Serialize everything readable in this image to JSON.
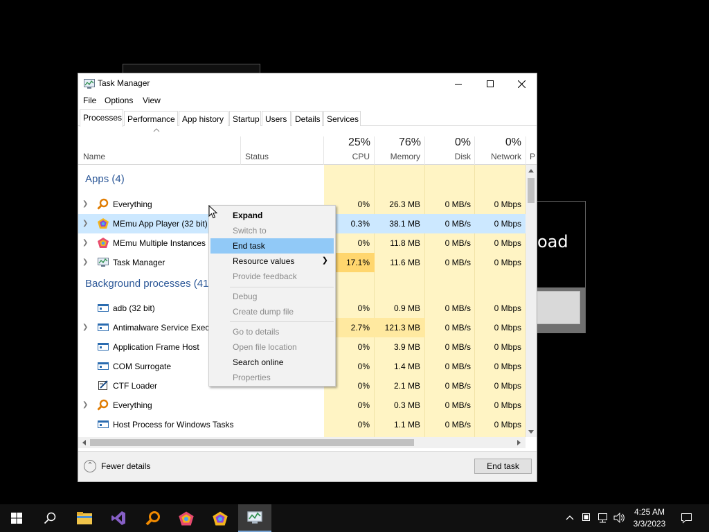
{
  "window": {
    "title": "Task Manager",
    "menu": [
      "File",
      "Options",
      "View"
    ],
    "tabs": [
      "Processes",
      "Performance",
      "App history",
      "Startup",
      "Users",
      "Details",
      "Services"
    ]
  },
  "columns": {
    "name": "Name",
    "status": "Status",
    "cpu": {
      "pct": "25%",
      "label": "CPU"
    },
    "memory": {
      "pct": "76%",
      "label": "Memory"
    },
    "disk": {
      "pct": "0%",
      "label": "Disk"
    },
    "network": {
      "pct": "0%",
      "label": "Network"
    },
    "power_partial": "P"
  },
  "groups": {
    "apps": "Apps (4)",
    "background": "Background processes (41"
  },
  "apps": [
    {
      "name": "Everything",
      "cpu": "0%",
      "mem": "26.3 MB",
      "disk": "0 MB/s",
      "net": "0 Mbps"
    },
    {
      "name": "MEmu App Player (32 bit)",
      "cpu": "0.3%",
      "mem": "38.1 MB",
      "disk": "0 MB/s",
      "net": "0 Mbps"
    },
    {
      "name": "MEmu Multiple Instances",
      "cpu": "0%",
      "mem": "11.8 MB",
      "disk": "0 MB/s",
      "net": "0 Mbps"
    },
    {
      "name": "Task Manager",
      "cpu": "17.1%",
      "mem": "11.6 MB",
      "disk": "0 MB/s",
      "net": "0 Mbps"
    }
  ],
  "background": [
    {
      "name": "adb (32 bit)",
      "cpu": "0%",
      "mem": "0.9 MB",
      "disk": "0 MB/s",
      "net": "0 Mbps"
    },
    {
      "name": "Antimalware Service Execu",
      "cpu": "2.7%",
      "mem": "121.3 MB",
      "disk": "0 MB/s",
      "net": "0 Mbps"
    },
    {
      "name": "Application Frame Host",
      "cpu": "0%",
      "mem": "3.9 MB",
      "disk": "0 MB/s",
      "net": "0 Mbps"
    },
    {
      "name": "COM Surrogate",
      "cpu": "0%",
      "mem": "1.4 MB",
      "disk": "0 MB/s",
      "net": "0 Mbps"
    },
    {
      "name": "CTF Loader",
      "cpu": "0%",
      "mem": "2.1 MB",
      "disk": "0 MB/s",
      "net": "0 Mbps"
    },
    {
      "name": "Everything",
      "cpu": "0%",
      "mem": "0.3 MB",
      "disk": "0 MB/s",
      "net": "0 Mbps"
    },
    {
      "name": "Host Process for Windows Tasks",
      "cpu": "0%",
      "mem": "1.1 MB",
      "disk": "0 MB/s",
      "net": "0 Mbps"
    }
  ],
  "context_menu": {
    "expand": "Expand",
    "switch_to": "Switch to",
    "end_task": "End task",
    "resource_values": "Resource values",
    "provide_feedback": "Provide feedback",
    "debug": "Debug",
    "create_dump": "Create dump file",
    "go_to_details": "Go to details",
    "open_file_location": "Open file location",
    "search_online": "Search online",
    "properties": "Properties"
  },
  "footer": {
    "fewer_details": "Fewer details",
    "end_task": "End task"
  },
  "background_dialog": {
    "text_fragment": "oad"
  },
  "clock": {
    "time": "4:25 AM",
    "date": "3/3/2023"
  },
  "colors": {
    "heat": "#fff4c4",
    "selection": "#cce8ff",
    "menu_highlight": "#91c9f7",
    "group_text": "#2b5797"
  }
}
